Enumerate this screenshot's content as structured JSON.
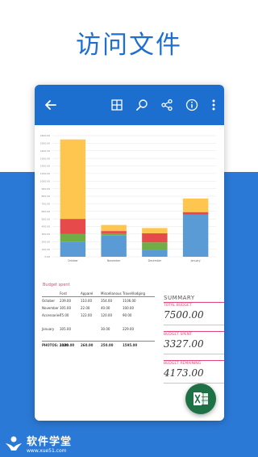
{
  "headline": "访问文件",
  "colors": {
    "accent": "#1f6fd1",
    "appbar": "#1c6ecf",
    "excel_green": "#1e7145",
    "label_pink": "#e0457b",
    "bar_blue": "#5b9bd5",
    "bar_green": "#70ad47",
    "bar_red": "#e64a4a",
    "bar_yellow": "#ffc64f"
  },
  "appbar": {
    "icons": [
      "back-arrow-icon",
      "grid-icon",
      "search-icon",
      "share-icon",
      "info-icon",
      "more-vertical-icon"
    ]
  },
  "chart_data": {
    "type": "bar",
    "stacked": true,
    "title": "",
    "xlabel": "",
    "ylabel": "",
    "ylim": [
      0,
      1600
    ],
    "yticks": [
      "0.00",
      "100.00",
      "200.00",
      "300.00",
      "400.00",
      "500.00",
      "600.00",
      "700.00",
      "800.00",
      "900.00",
      "1000.00",
      "1100.00",
      "1200.00",
      "1300.00",
      "1400.00",
      "1500.00",
      "1600.00"
    ],
    "categories": [
      "October",
      "November",
      "December",
      "January"
    ],
    "series": [
      {
        "color": "#5b9bd5",
        "values": [
          200,
          280,
          90,
          560
        ]
      },
      {
        "color": "#70ad47",
        "values": [
          100,
          30,
          100,
          0
        ]
      },
      {
        "color": "#e64a4a",
        "values": [
          200,
          30,
          120,
          30
        ]
      },
      {
        "color": "#ffc64f",
        "values": [
          1050,
          80,
          70,
          180
        ]
      }
    ],
    "grid": true
  },
  "sheet": {
    "title": "Budget spent",
    "headers": [
      "",
      "Ford",
      "Apparel",
      "Miscellanous",
      "Travel/lodging"
    ],
    "rows": [
      [
        "October",
        "239.00",
        "110.00",
        "354.00",
        "1106.00"
      ],
      [
        "November",
        "305.00",
        "22.00",
        "40.00",
        "100.00"
      ],
      [
        "Accessories",
        "75.00",
        "122.00",
        "120.00",
        "90.00"
      ],
      [
        "January",
        "305.00",
        "",
        "30.00",
        "229.00"
      ]
    ],
    "total": [
      "PHOTOS: 2020",
      "1100.00",
      "260.00",
      "250.00",
      "1595.00"
    ]
  },
  "summary": {
    "title": "SUMMARY",
    "items": [
      {
        "label": "TOTAL BUDGET",
        "value": "7500.00"
      },
      {
        "label": "BUDGET SPENT",
        "value": "3327.00"
      },
      {
        "label": "BUDGET REMAINING",
        "value": "4173.00"
      }
    ]
  },
  "fab": {
    "icon": "excel-icon"
  },
  "brand": {
    "name": "软件学堂",
    "url": "www.xue51.com"
  }
}
